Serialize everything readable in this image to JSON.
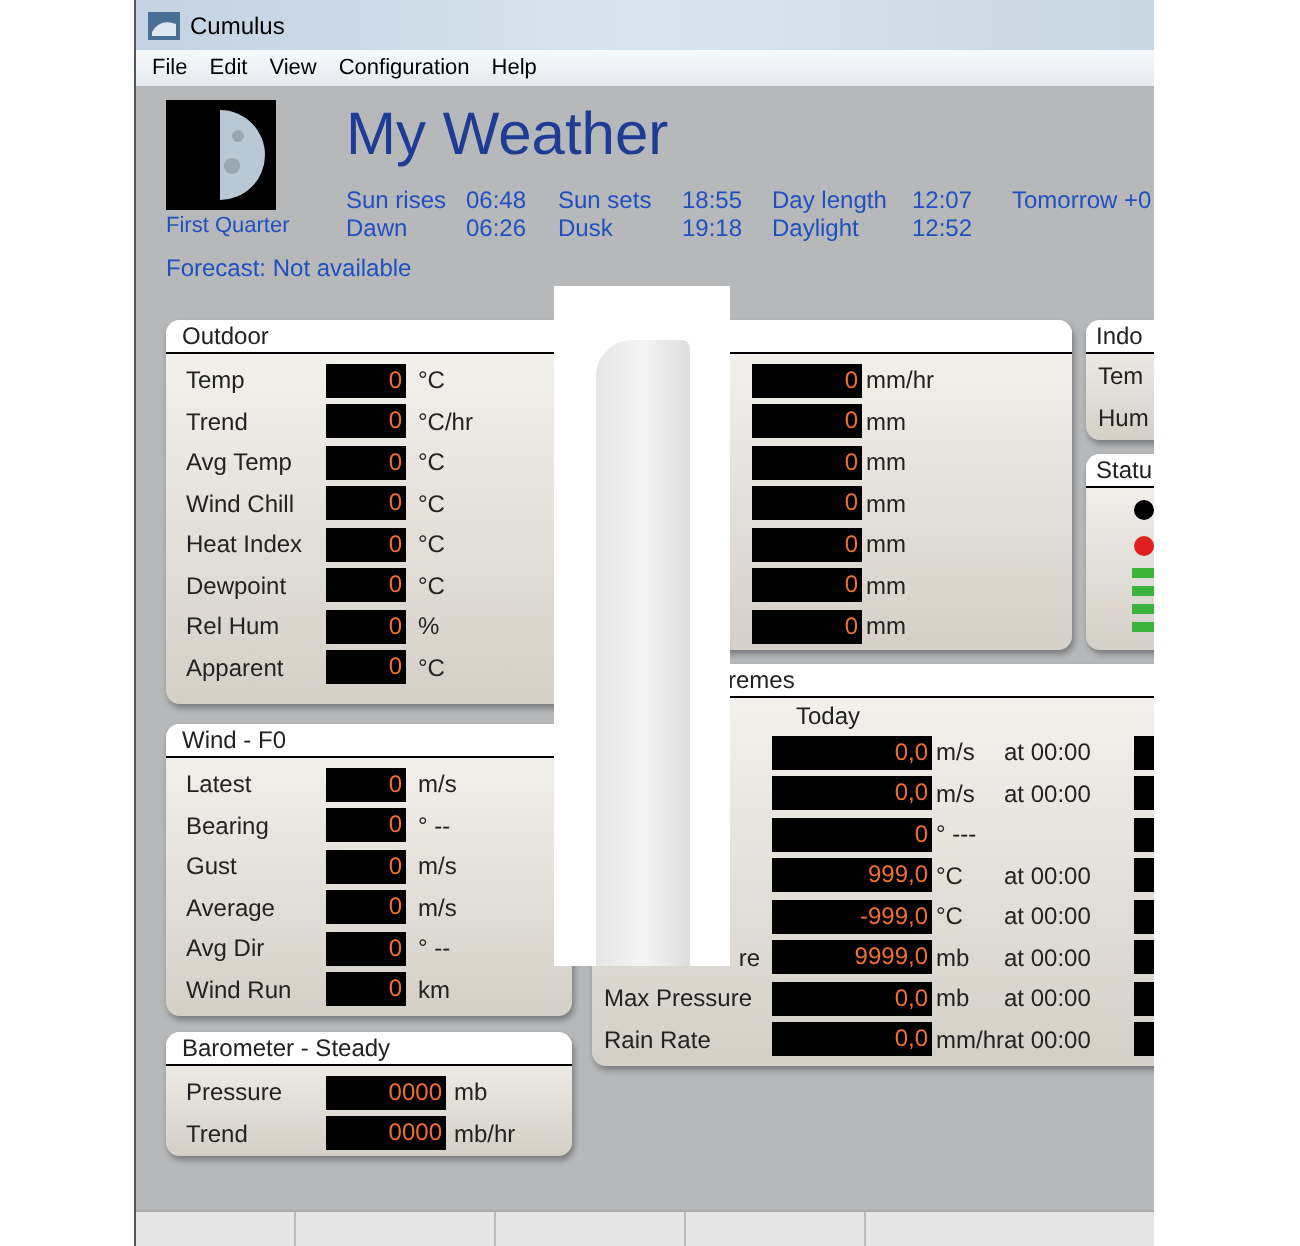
{
  "window": {
    "title": "Cumulus"
  },
  "menu": [
    "File",
    "Edit",
    "View",
    "Configuration",
    "Help"
  ],
  "header": {
    "moon_phase": "First Quarter",
    "station": "My Weather",
    "sun_rows": [
      [
        "Sun rises",
        "06:48",
        "Sun sets",
        "18:55",
        "Day length",
        "12:07",
        "Tomorrow +0"
      ],
      [
        "Dawn",
        "06:26",
        "Dusk",
        "19:18",
        "Daylight",
        "12:52"
      ]
    ],
    "forecast": "Forecast: Not available"
  },
  "outdoor": {
    "title": "Outdoor",
    "rows": [
      {
        "label": "Temp",
        "value": "0",
        "unit": "°C"
      },
      {
        "label": "Trend",
        "value": "0",
        "unit": "°C/hr"
      },
      {
        "label": "Avg Temp",
        "value": "0",
        "unit": "°C"
      },
      {
        "label": "Wind Chill",
        "value": "0",
        "unit": "°C"
      },
      {
        "label": "Heat Index",
        "value": "0",
        "unit": "°C"
      },
      {
        "label": "Dewpoint",
        "value": "0",
        "unit": "°C"
      },
      {
        "label": "Rel Hum",
        "value": "0",
        "unit": "%"
      },
      {
        "label": "Apparent",
        "value": "0",
        "unit": "°C"
      }
    ]
  },
  "rain": {
    "rows": [
      {
        "value": "0",
        "unit": "mm/hr"
      },
      {
        "value": "0",
        "unit": "mm"
      },
      {
        "value": "0",
        "unit": "mm"
      },
      {
        "value": "0",
        "unit": "mm"
      },
      {
        "value": "0",
        "unit": "mm"
      },
      {
        "value": "0",
        "unit": "mm"
      },
      {
        "value": "0",
        "unit": "mm"
      }
    ]
  },
  "indoor": {
    "title": "Indo",
    "rows": [
      "Tem",
      "Hum"
    ]
  },
  "status": {
    "title": "Statu",
    "items": [
      {
        "kind": "dot",
        "color": "#000000"
      },
      {
        "kind": "dot",
        "color": "#e02020"
      },
      {
        "kind": "bar",
        "color": "#3cb43c"
      },
      {
        "kind": "bar",
        "color": "#3cb43c"
      },
      {
        "kind": "bar",
        "color": "#3cb43c"
      },
      {
        "kind": "bar",
        "color": "#3cb43c"
      }
    ]
  },
  "wind": {
    "title": "Wind - F0",
    "rows": [
      {
        "label": "Latest",
        "value": "0",
        "unit": "m/s"
      },
      {
        "label": "Bearing",
        "value": "0",
        "unit": "° --"
      },
      {
        "label": "Gust",
        "value": "0",
        "unit": "m/s"
      },
      {
        "label": "Average",
        "value": "0",
        "unit": "m/s"
      },
      {
        "label": "Avg Dir",
        "value": "0",
        "unit": "° --"
      },
      {
        "label": "Wind Run",
        "value": "0",
        "unit": "km"
      }
    ]
  },
  "barometer": {
    "title": "Barometer - Steady",
    "rows": [
      {
        "label": "Pressure",
        "value": "0000",
        "unit": "mb"
      },
      {
        "label": "Trend",
        "value": "0000",
        "unit": "mb/hr"
      }
    ]
  },
  "extremes": {
    "title": "remes",
    "column": "Today",
    "rows": [
      {
        "kind": "full",
        "value": "0,0",
        "unit": "m/s",
        "time": "at 00:00"
      },
      {
        "kind": "full",
        "value": "0,0",
        "unit": "m/s",
        "time": "at 00:00"
      },
      {
        "kind": "full",
        "value": "0",
        "unit": "° ---"
      },
      {
        "kind": "full",
        "value": "999,0",
        "unit": "°C",
        "time": "at 00:00"
      },
      {
        "kind": "full",
        "value": "-999,0",
        "unit": "°C",
        "time": "at 00:00"
      },
      {
        "kind": "partial",
        "label": "re",
        "value": "9999,0",
        "unit": "mb",
        "time": "at 00:00"
      },
      {
        "kind": "full",
        "label": "Max Pressure",
        "value": "0,0",
        "unit": "mb",
        "time": "at 00:00"
      },
      {
        "kind": "full",
        "label": "Rain Rate",
        "value": "0,0",
        "unit": "mm/hr",
        "time": "at 00:00"
      }
    ]
  }
}
